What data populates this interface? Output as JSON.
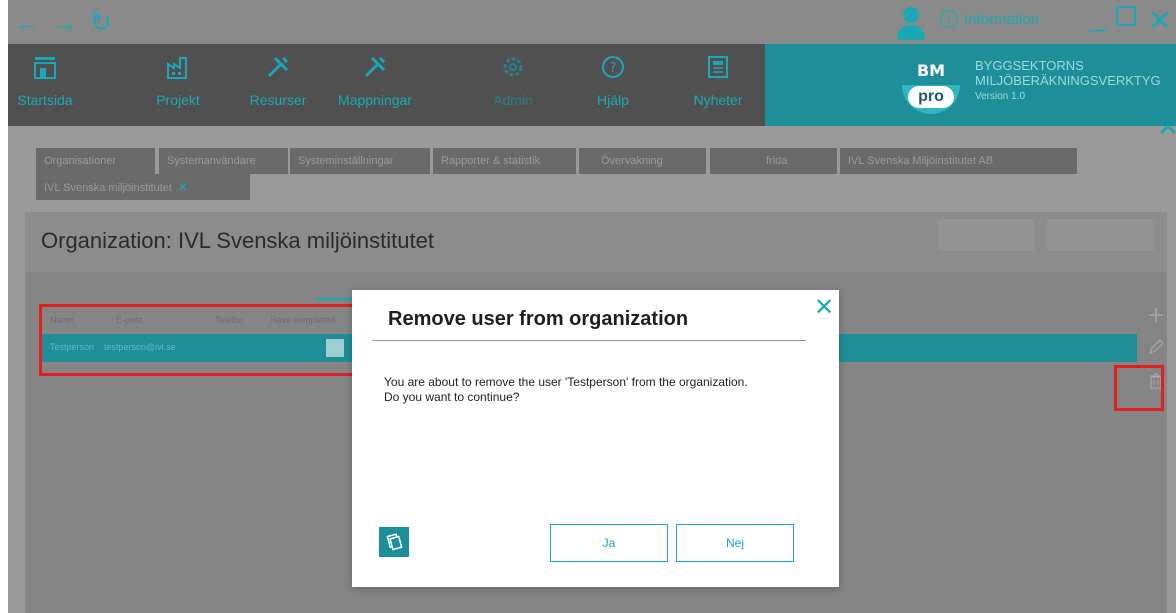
{
  "titlebar": {
    "back_icon": "arrow-left",
    "forward_icon": "arrow-right",
    "refresh_icon": "refresh",
    "info_label": "Information",
    "minimize_icon": "minimize",
    "maximize_icon": "maximize",
    "close_icon": "close"
  },
  "nav": {
    "items": [
      {
        "label": "Startsida",
        "icon": "home-icon"
      },
      {
        "label": "Projekt",
        "icon": "factory-icon"
      },
      {
        "label": "Resurser",
        "icon": "tools-icon"
      },
      {
        "label": "Mappningar",
        "icon": "tools-icon"
      },
      {
        "label": "Admin",
        "icon": "gear-icon"
      },
      {
        "label": "Hjälp",
        "icon": "help-icon"
      },
      {
        "label": "Nyheter",
        "icon": "newspaper-icon"
      }
    ],
    "active": "Admin"
  },
  "brand": {
    "logo_top": "BM",
    "logo_bottom": "pro",
    "name_line1": "BYGGSEKTORNS",
    "name_line2": "MILJÖBERÄKNINGSVERKTYG",
    "version": "Version 1.0"
  },
  "tabs": [
    "Organisationer",
    "Systemanvändare",
    "Systeminställningar",
    "Rapporter & statistik",
    "Övervakning",
    "frida",
    "IVL Svenska Miljöinstitutet AB",
    "IVL Svenska miljöinstitutet"
  ],
  "tab_close": "✕",
  "panel": {
    "title": "Organization: IVL Svenska miljöinstitutet"
  },
  "grid": {
    "headers": [
      "Namn",
      "E-post",
      "Telefon",
      "Have completed"
    ],
    "rows": [
      {
        "name": "Testperson",
        "email": "testperson@ivl.se"
      }
    ]
  },
  "modal": {
    "title": "Remove user from organization",
    "close": "✕",
    "message_line1": "You are about to remove the user 'Testperson' from the organization.",
    "message_line2": "Do you want to continue?",
    "yes_label": "Ja",
    "no_label": "Nej"
  },
  "colors": {
    "accent": "#1aa9b4",
    "highlight": "#e11f1f",
    "navbar": "#505050",
    "brand": "#1e8f98"
  }
}
